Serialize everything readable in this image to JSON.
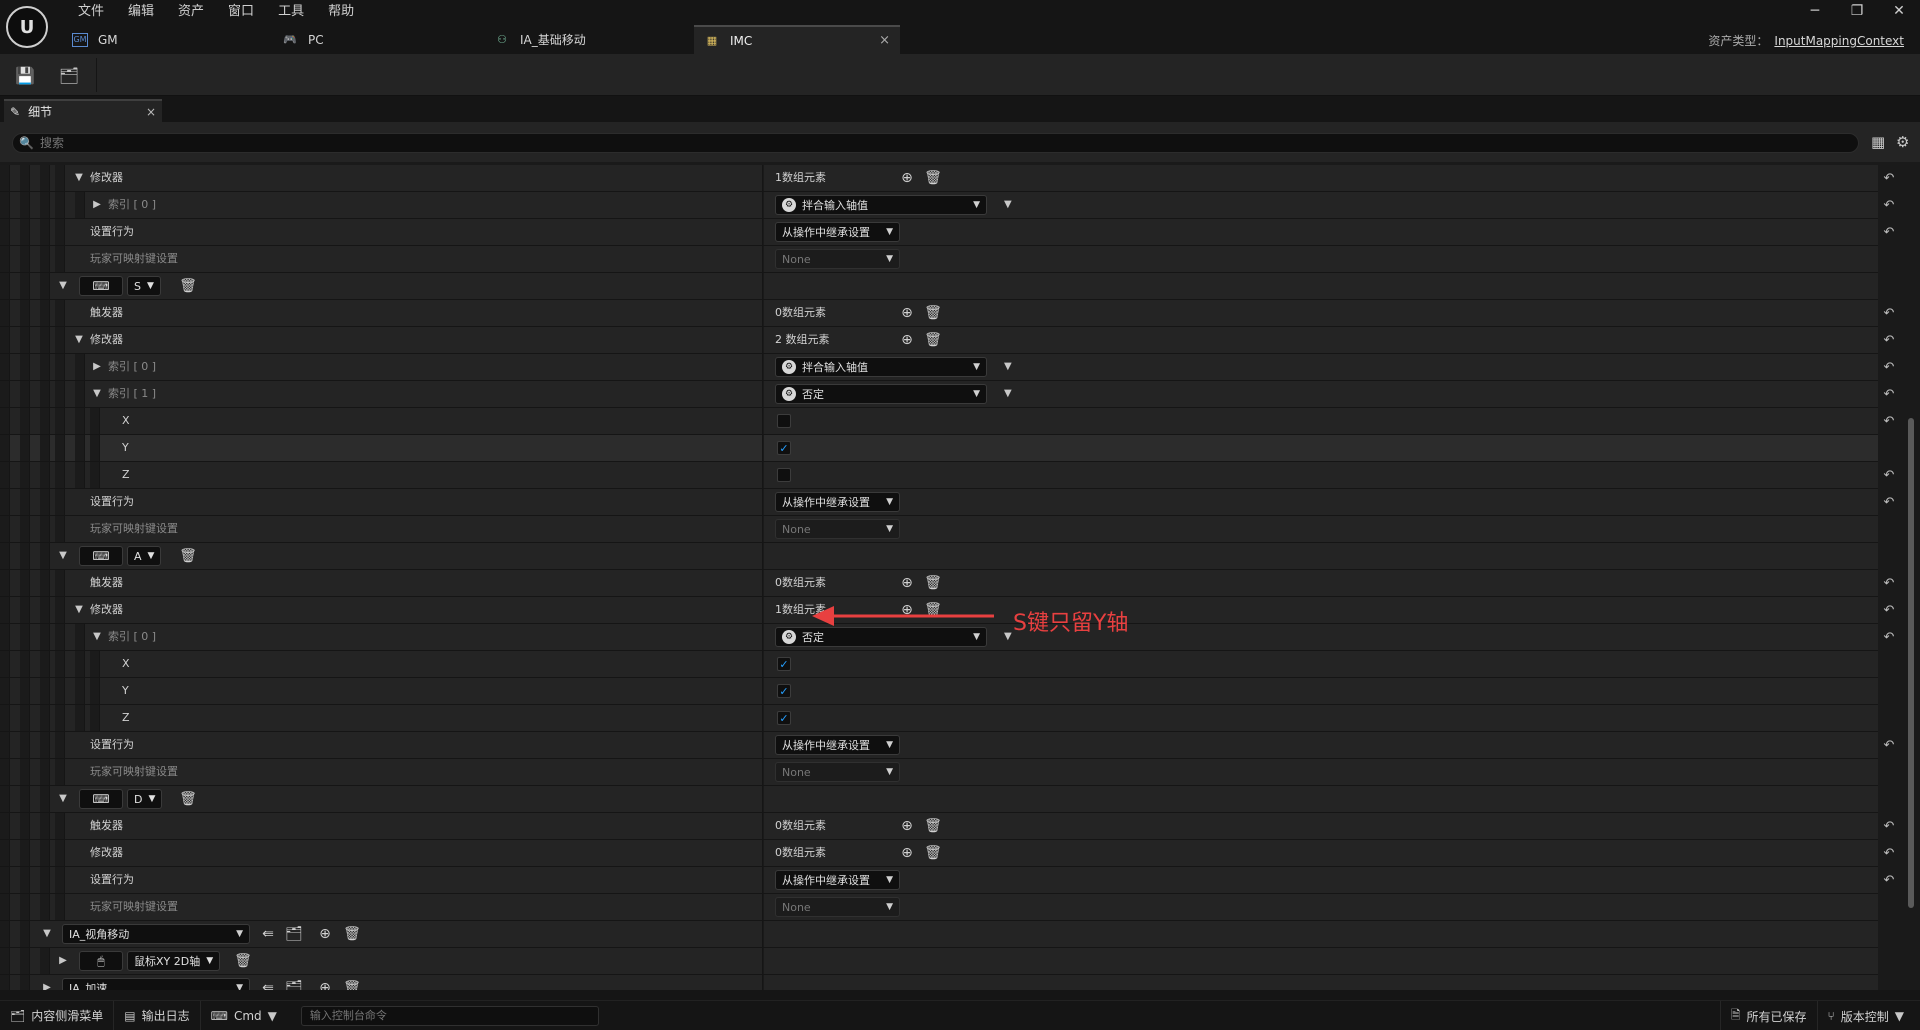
{
  "menu": [
    "文件",
    "编辑",
    "资产",
    "窗口",
    "工具",
    "帮助"
  ],
  "window_controls": {
    "minimize": "─",
    "restore": "❐",
    "close": "✕"
  },
  "tabs": [
    {
      "label": "GM",
      "icon": "blueprint-icon"
    },
    {
      "label": "PC",
      "icon": "gamepad-icon"
    },
    {
      "label": "IA_基础移动",
      "icon": "input-action-icon"
    },
    {
      "label": "IMC",
      "icon": "mapping-context-icon",
      "close": "×"
    }
  ],
  "asset_type": {
    "label": "资产类型：",
    "value": "InputMappingContext"
  },
  "panel": {
    "title": "细节",
    "close": "×"
  },
  "search": {
    "placeholder": "搜索"
  },
  "labels": {
    "modifiers": "修改器",
    "triggers": "触发器",
    "setting_behavior": "设置行为",
    "player_mappable": "玩家可映射键设置",
    "index0": "索引 [ 0 ]",
    "index1": "索引 [ 1 ]",
    "x": "X",
    "y": "Y",
    "z": "Z"
  },
  "values": {
    "one_elem": "1数组元素",
    "zero_elem": "0数组元素",
    "two_elem": "2 数组元素",
    "swizzle": "拌合输入轴值",
    "negate": "否定",
    "inherit": "从操作中继承设置",
    "none": "None"
  },
  "keys": {
    "s": "S",
    "a": "A",
    "d": "D",
    "mouse": "鼠标XY 2D轴"
  },
  "actions": {
    "look": "IA_视角移动",
    "accel": "IA_加速"
  },
  "annotation": {
    "text": "S键只留Y轴",
    "color": "#e84040"
  },
  "status": {
    "content_drawer": "内容侧滑菜单",
    "output_log": "输出日志",
    "cmd": "Cmd",
    "cmd_placeholder": "输入控制台命令",
    "saved": "所有已保存",
    "version": "版本控制"
  }
}
